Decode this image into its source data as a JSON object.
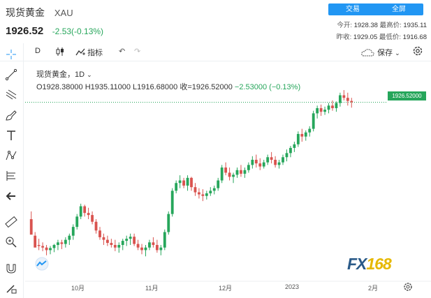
{
  "header": {
    "title": "现货黄金",
    "code": "XAU",
    "price": "1926.52",
    "change": "-2.53(-0.13%)",
    "trade_label": "交易",
    "fullscreen_label": "全屏",
    "stats": {
      "open_label": "今开:",
      "open": "1928.38",
      "high_label": "最高价:",
      "high": "1935.11",
      "prev_close_label": "昨收:",
      "prev_close": "1929.05",
      "low_label": "最低价:",
      "low": "1916.68"
    }
  },
  "toolbar": {
    "interval": "D",
    "indicator_label": "指标",
    "save_label": "保存"
  },
  "legend": {
    "title": "现货黄金，1D",
    "ohlc": "O1928.38000 H1935.11000 L1916.68000 收=1926.52000",
    "change": "−2.53000 (−0.13%)"
  },
  "price_tag": "1926.52000",
  "xaxis": {
    "labels": [
      "10月",
      "11月",
      "12月",
      "2023",
      "2月"
    ]
  },
  "logo": {
    "text_a": "FX",
    "text_b": "168"
  },
  "colors": {
    "up": "#26a65b",
    "down": "#d9534f",
    "accent": "#2196f3"
  },
  "chart_data": {
    "type": "candlestick",
    "x_labels": [
      "10月",
      "11月",
      "12月",
      "2023",
      "2月"
    ],
    "last_close": 1926.52,
    "candles": [
      [
        1700,
        1715,
        1690,
        1670
      ],
      [
        1668,
        1675,
        1650,
        1645
      ],
      [
        1650,
        1662,
        1640,
        1648
      ],
      [
        1648,
        1655,
        1638,
        1645
      ],
      [
        1645,
        1650,
        1630,
        1640
      ],
      [
        1640,
        1648,
        1632,
        1644
      ],
      [
        1644,
        1652,
        1636,
        1650
      ],
      [
        1650,
        1660,
        1640,
        1655
      ],
      [
        1655,
        1660,
        1642,
        1652
      ],
      [
        1652,
        1665,
        1645,
        1660
      ],
      [
        1660,
        1672,
        1650,
        1668
      ],
      [
        1668,
        1690,
        1660,
        1685
      ],
      [
        1685,
        1710,
        1680,
        1705
      ],
      [
        1705,
        1730,
        1700,
        1725
      ],
      [
        1725,
        1728,
        1705,
        1712
      ],
      [
        1712,
        1722,
        1700,
        1708
      ],
      [
        1708,
        1715,
        1690,
        1695
      ],
      [
        1695,
        1700,
        1672,
        1678
      ],
      [
        1678,
        1685,
        1660,
        1665
      ],
      [
        1665,
        1672,
        1650,
        1660
      ],
      [
        1660,
        1668,
        1648,
        1654
      ],
      [
        1654,
        1662,
        1645,
        1650
      ],
      [
        1650,
        1660,
        1638,
        1645
      ],
      [
        1645,
        1655,
        1635,
        1650
      ],
      [
        1650,
        1662,
        1640,
        1658
      ],
      [
        1658,
        1668,
        1648,
        1662
      ],
      [
        1662,
        1672,
        1650,
        1666
      ],
      [
        1666,
        1672,
        1648,
        1652
      ],
      [
        1652,
        1660,
        1640,
        1645
      ],
      [
        1645,
        1652,
        1632,
        1640
      ],
      [
        1640,
        1650,
        1628,
        1645
      ],
      [
        1645,
        1660,
        1640,
        1655
      ],
      [
        1655,
        1665,
        1645,
        1650
      ],
      [
        1650,
        1660,
        1635,
        1640
      ],
      [
        1640,
        1650,
        1630,
        1645
      ],
      [
        1645,
        1680,
        1640,
        1675
      ],
      [
        1675,
        1715,
        1670,
        1710
      ],
      [
        1710,
        1760,
        1705,
        1755
      ],
      [
        1755,
        1775,
        1750,
        1770
      ],
      [
        1770,
        1785,
        1760,
        1775
      ],
      [
        1775,
        1780,
        1760,
        1765
      ],
      [
        1765,
        1785,
        1755,
        1780
      ],
      [
        1780,
        1782,
        1755,
        1762
      ],
      [
        1762,
        1770,
        1745,
        1752
      ],
      [
        1752,
        1760,
        1740,
        1748
      ],
      [
        1748,
        1758,
        1735,
        1745
      ],
      [
        1745,
        1755,
        1738,
        1750
      ],
      [
        1750,
        1762,
        1745,
        1755
      ],
      [
        1755,
        1765,
        1748,
        1760
      ],
      [
        1760,
        1780,
        1755,
        1775
      ],
      [
        1775,
        1805,
        1770,
        1800
      ],
      [
        1800,
        1810,
        1785,
        1790
      ],
      [
        1790,
        1800,
        1775,
        1782
      ],
      [
        1782,
        1790,
        1770,
        1786
      ],
      [
        1786,
        1800,
        1780,
        1795
      ],
      [
        1795,
        1805,
        1782,
        1788
      ],
      [
        1788,
        1800,
        1780,
        1795
      ],
      [
        1795,
        1810,
        1790,
        1805
      ],
      [
        1805,
        1822,
        1798,
        1815
      ],
      [
        1815,
        1825,
        1800,
        1808
      ],
      [
        1808,
        1818,
        1795,
        1802
      ],
      [
        1802,
        1815,
        1798,
        1810
      ],
      [
        1810,
        1825,
        1805,
        1820
      ],
      [
        1820,
        1830,
        1808,
        1815
      ],
      [
        1815,
        1822,
        1800,
        1805
      ],
      [
        1805,
        1815,
        1798,
        1810
      ],
      [
        1810,
        1825,
        1805,
        1820
      ],
      [
        1820,
        1835,
        1812,
        1828
      ],
      [
        1828,
        1842,
        1820,
        1838
      ],
      [
        1838,
        1850,
        1830,
        1845
      ],
      [
        1845,
        1870,
        1840,
        1865
      ],
      [
        1865,
        1875,
        1850,
        1860
      ],
      [
        1860,
        1872,
        1852,
        1868
      ],
      [
        1868,
        1880,
        1860,
        1875
      ],
      [
        1875,
        1910,
        1870,
        1905
      ],
      [
        1905,
        1920,
        1895,
        1915
      ],
      [
        1915,
        1922,
        1900,
        1908
      ],
      [
        1908,
        1918,
        1902,
        1912
      ],
      [
        1912,
        1925,
        1905,
        1920
      ],
      [
        1920,
        1930,
        1910,
        1915
      ],
      [
        1915,
        1928,
        1908,
        1925
      ],
      [
        1925,
        1945,
        1918,
        1940
      ],
      [
        1940,
        1950,
        1930,
        1935
      ],
      [
        1935,
        1945,
        1920,
        1929
      ],
      [
        1929,
        1935,
        1916,
        1926.52
      ]
    ]
  }
}
